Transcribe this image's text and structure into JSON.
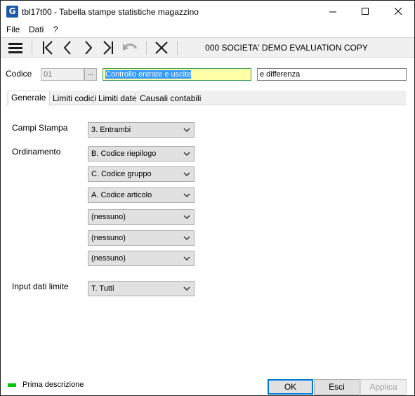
{
  "window": {
    "title": "tbl17t00 - Tabella stampe statistiche magazzino",
    "app_icon_letter": "G"
  },
  "menu": [
    {
      "label": "File"
    },
    {
      "label": "Dati"
    },
    {
      "label": "?"
    }
  ],
  "toolbar": {
    "company": "000 SOCIETA' DEMO EVALUATION COPY",
    "icons": [
      "menu-icon",
      "first-record-icon",
      "previous-record-icon",
      "next-record-icon",
      "last-record-icon",
      "undo-icon",
      "delete-icon"
    ]
  },
  "header": {
    "codice_label": "Codice",
    "codice_value": "01",
    "lookup_label": "...",
    "descrizione_value": "Controllo entrate e uscite",
    "descrizione2_value": "e differenza"
  },
  "tabs": [
    {
      "label": "Generale",
      "active": true
    },
    {
      "label": "Limiti codici",
      "active": false
    },
    {
      "label": "Limiti date",
      "active": false
    },
    {
      "label": "Causali contabili",
      "active": false
    }
  ],
  "form": {
    "campi_stampa_label": "Campi Stampa",
    "campi_stampa_value": "3. Entrambi",
    "ordinamento_label": "Ordinamento",
    "ordinamento_values": [
      "B. Codice riepilogo",
      "C. Codice gruppo",
      "A. Codice articolo",
      "(nessuno)",
      "(nessuno)",
      "(nessuno)"
    ],
    "input_dati_limite_label": "Input dati limite",
    "input_dati_limite_value": "T. Tutti"
  },
  "footer": {
    "status_text": "Prima descrizione",
    "status_color": "#00c800",
    "ok_label": "OK",
    "esci_label": "Esci",
    "applica_label": "Applica"
  }
}
